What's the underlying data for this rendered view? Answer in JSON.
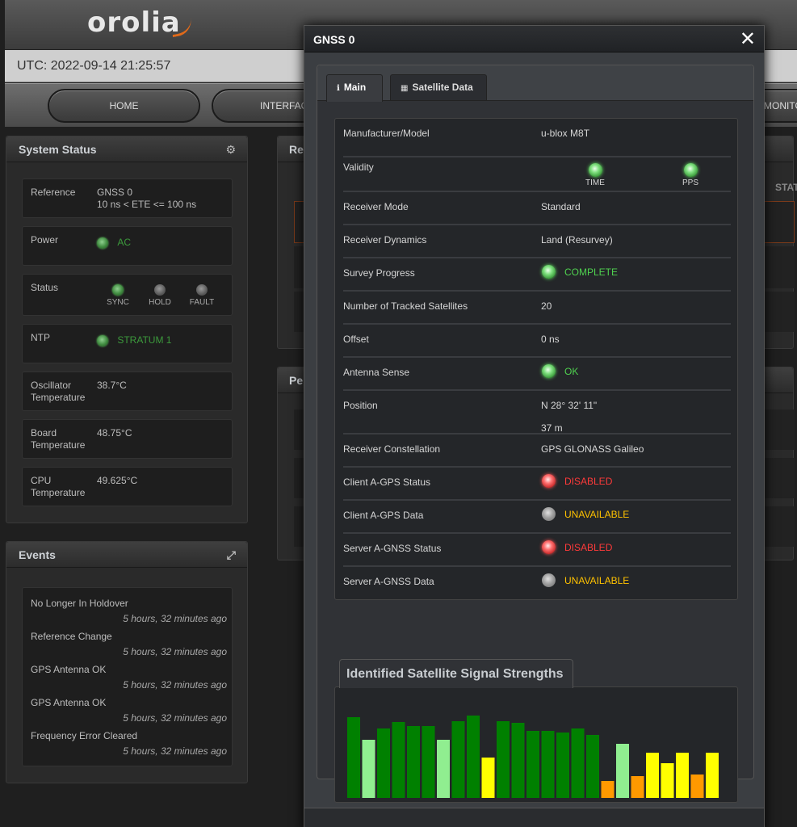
{
  "header": {
    "logo_text": "orolia",
    "utc": "UTC: 2022-09-14 21:25:57",
    "nav": [
      "HOME",
      "INTERFACES",
      "MONITORING"
    ]
  },
  "system_status": {
    "title": "System Status",
    "reference": {
      "label": "Reference",
      "line1": "GNSS 0",
      "line2": "10 ns < ETE <= 100 ns"
    },
    "power": {
      "label": "Power",
      "value": "AC"
    },
    "status": {
      "label": "Status",
      "leds": [
        "SYNC",
        "HOLD",
        "FAULT"
      ]
    },
    "ntp": {
      "label": "NTP",
      "value": "STRATUM 1"
    },
    "osc_temp": {
      "label1": "Oscillator",
      "label2": "Temperature",
      "value": "38.7°C"
    },
    "board_temp": {
      "label1": "Board",
      "label2": "Temperature",
      "value": "48.75°C"
    },
    "cpu_temp": {
      "label1": "CPU",
      "label2": "Temperature",
      "value": "49.625°C"
    }
  },
  "events": {
    "title": "Events",
    "items": [
      {
        "title": "No Longer In Holdover",
        "time": "5 hours, 32 minutes ago"
      },
      {
        "title": "Reference Change",
        "time": "5 hours, 32 minutes ago"
      },
      {
        "title": "GPS Antenna OK",
        "time": "5 hours, 32 minutes ago"
      },
      {
        "title": "GPS Antenna OK",
        "time": "5 hours, 32 minutes ago"
      },
      {
        "title": "Frequency Error Cleared",
        "time": "5 hours, 32 minutes ago"
      }
    ]
  },
  "background_panels": {
    "ref_title_fragment": "Re",
    "perf_title_fragment": "Pe",
    "status_col_fragment": "STAT"
  },
  "modal": {
    "title": "GNSS 0",
    "close": "✕",
    "tabs": {
      "main": "Main",
      "satellite": "Satellite Data"
    },
    "rows": {
      "manufacturer": {
        "label": "Manufacturer/Model",
        "value": "u-blox M8T"
      },
      "validity": {
        "label": "Validity",
        "time": "TIME",
        "pps": "PPS"
      },
      "receiver_mode": {
        "label": "Receiver Mode",
        "value": "Standard"
      },
      "receiver_dynamics": {
        "label": "Receiver Dynamics",
        "value": "Land (Resurvey)"
      },
      "survey_progress": {
        "label": "Survey Progress",
        "value": "COMPLETE"
      },
      "tracked_sats": {
        "label": "Number of Tracked Satellites",
        "value": "20"
      },
      "offset": {
        "label": "Offset",
        "value": "0 ns"
      },
      "antenna_sense": {
        "label": "Antenna Sense",
        "value": "OK"
      },
      "position": {
        "label": "Position",
        "line1": "N 28° 32' 11\"",
        "line2": "37 m"
      },
      "constellation": {
        "label": "Receiver Constellation",
        "value": "GPS GLONASS Galileo"
      },
      "client_agps_status": {
        "label": "Client A-GPS Status",
        "value": "DISABLED"
      },
      "client_agps_data": {
        "label": "Client A-GPS Data",
        "value": "UNAVAILABLE"
      },
      "server_agnss_status": {
        "label": "Server A-GNSS Status",
        "value": "DISABLED"
      },
      "server_agnss_data": {
        "label": "Server A-GNSS Data",
        "value": "UNAVAILABLE"
      }
    },
    "signal_title": "Identified Satellite Signal Strengths"
  },
  "colors": {
    "strong": "#008000",
    "good": "#90ee90",
    "fair": "#ffff00",
    "weak": "#ff9900"
  },
  "chart_data": {
    "type": "bar",
    "title": "Identified Satellite Signal Strengths",
    "ylim": [
      0,
      100
    ],
    "values": [
      {
        "v": 100,
        "c": "strong"
      },
      {
        "v": 72,
        "c": "good"
      },
      {
        "v": 86,
        "c": "strong"
      },
      {
        "v": 94,
        "c": "strong"
      },
      {
        "v": 89,
        "c": "strong"
      },
      {
        "v": 89,
        "c": "strong"
      },
      {
        "v": 72,
        "c": "good"
      },
      {
        "v": 95,
        "c": "strong"
      },
      {
        "v": 102,
        "c": "strong"
      },
      {
        "v": 50,
        "c": "fair"
      },
      {
        "v": 95,
        "c": "strong"
      },
      {
        "v": 93,
        "c": "strong"
      },
      {
        "v": 83,
        "c": "strong"
      },
      {
        "v": 83,
        "c": "strong"
      },
      {
        "v": 81,
        "c": "strong"
      },
      {
        "v": 86,
        "c": "strong"
      },
      {
        "v": 78,
        "c": "strong"
      },
      {
        "v": 21,
        "c": "weak"
      },
      {
        "v": 67,
        "c": "good"
      },
      {
        "v": 27,
        "c": "weak"
      },
      {
        "v": 56,
        "c": "fair"
      },
      {
        "v": 43,
        "c": "fair"
      },
      {
        "v": 56,
        "c": "fair"
      },
      {
        "v": 29,
        "c": "weak"
      },
      {
        "v": 56,
        "c": "fair"
      }
    ]
  }
}
